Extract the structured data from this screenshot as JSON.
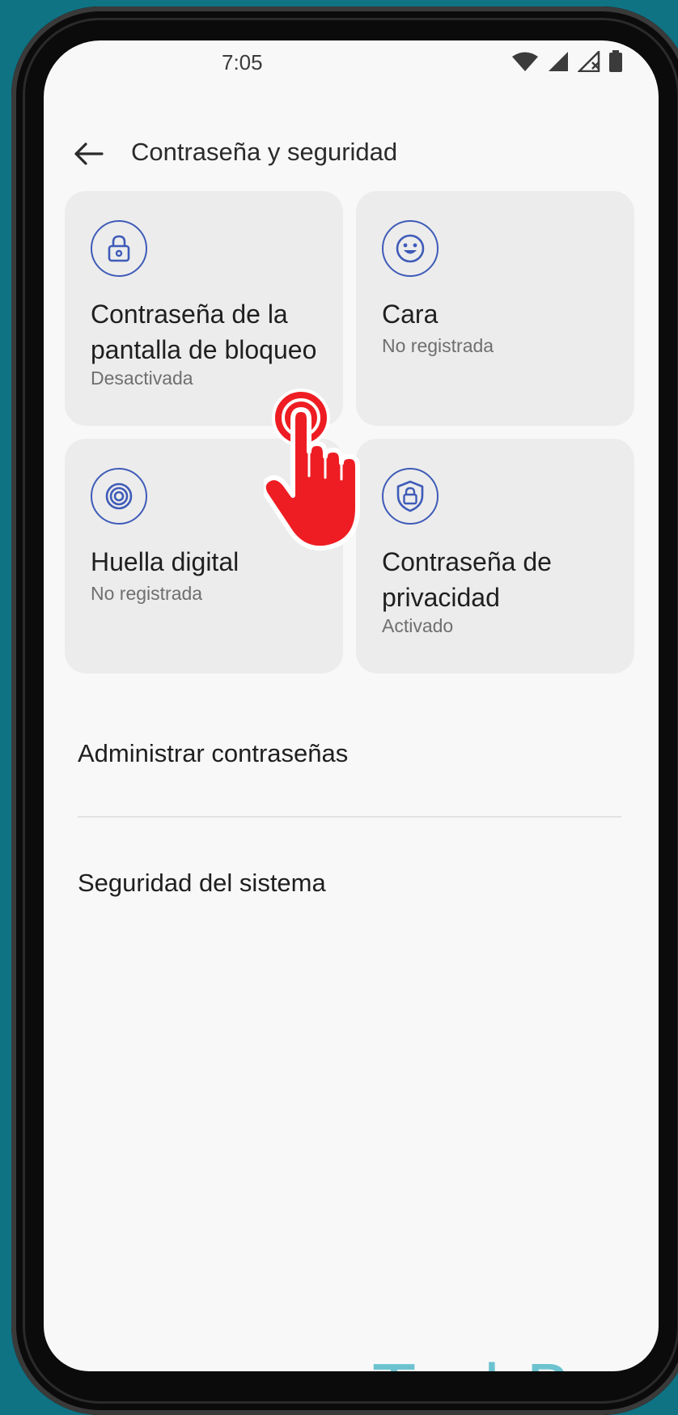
{
  "status_bar": {
    "time": "7:05",
    "icons": [
      "wifi-icon",
      "signal-icon",
      "signal-x-icon",
      "battery-icon"
    ]
  },
  "app_bar": {
    "title": "Contraseña y seguridad",
    "back_icon": "arrow-left-icon"
  },
  "tiles": [
    {
      "icon": "lock-icon",
      "title_line1": "Contraseña de la",
      "title_line2": "pantalla de bloqueo",
      "subtitle": "Desactivada"
    },
    {
      "icon": "smiley-face-icon",
      "title_line1": "Cara",
      "subtitle": "No registrada"
    },
    {
      "icon": "fingerprint-icon",
      "title_line1": "Huella digital",
      "subtitle": "No registrada"
    },
    {
      "icon": "shield-lock-icon",
      "title_line1": "Contraseña de",
      "title_line2": "privacidad",
      "subtitle": "Activado"
    }
  ],
  "list": [
    {
      "label": "Administrar contraseñas"
    },
    {
      "label": "Seguridad del sistema"
    }
  ],
  "overlay": {
    "icon": "tap-hand-icon"
  },
  "watermark": "TechBone",
  "colors": {
    "accent": "#3e5bb8",
    "tile_bg": "#ececec",
    "screen_bg": "#f8f8f9",
    "tap_red": "#ee1d23",
    "frame_bg": "#0f7384"
  }
}
